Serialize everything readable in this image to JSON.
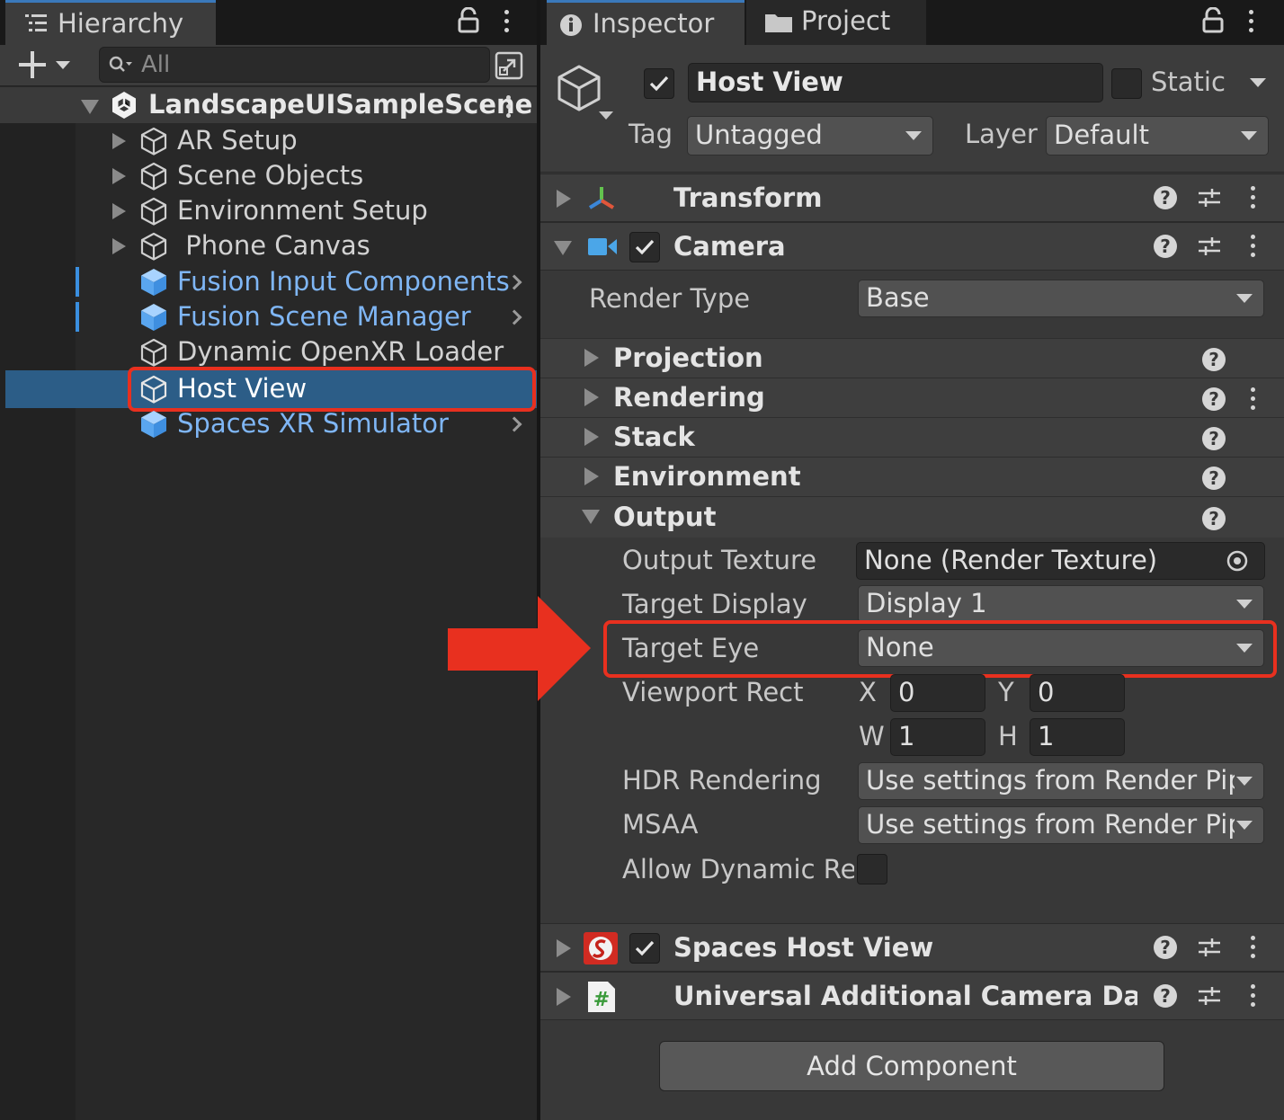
{
  "hierarchy": {
    "tab_title": "Hierarchy",
    "search_placeholder": "All",
    "scene_name": "LandscapeUISampleScene",
    "items": [
      {
        "label": "AR Setup",
        "type": "gameobject",
        "expandable": true
      },
      {
        "label": "Scene Objects",
        "type": "gameobject",
        "expandable": true
      },
      {
        "label": "Environment Setup",
        "type": "gameobject",
        "expandable": true
      },
      {
        "label": " Phone Canvas",
        "type": "gameobject",
        "expandable": true
      },
      {
        "label": "Fusion Input Components",
        "type": "prefab",
        "expandable": false
      },
      {
        "label": "Fusion Scene Manager",
        "type": "prefab",
        "expandable": false
      },
      {
        "label": "Dynamic OpenXR Loader",
        "type": "gameobject",
        "expandable": false
      },
      {
        "label": "Host View",
        "type": "gameobject",
        "selected": true
      },
      {
        "label": "Spaces XR Simulator",
        "type": "prefab",
        "expandable": false
      }
    ]
  },
  "inspector": {
    "tab_title": "Inspector",
    "project_tab_title": "Project",
    "object_name": "Host View",
    "active": true,
    "static_label": "Static",
    "static_checked": false,
    "tag_label": "Tag",
    "tag_value": "Untagged",
    "layer_label": "Layer",
    "layer_value": "Default",
    "components": {
      "transform": "Transform",
      "camera": "Camera",
      "spaces_host_view": "Spaces Host View",
      "universal_data": "Universal Additional Camera Data (S"
    },
    "camera": {
      "render_type_label": "Render Type",
      "render_type_value": "Base",
      "sections": [
        "Projection",
        "Rendering",
        "Stack",
        "Environment",
        "Output"
      ],
      "output": {
        "output_texture_label": "Output Texture",
        "output_texture_value": "None (Render Texture)",
        "target_display_label": "Target Display",
        "target_display_value": "Display 1",
        "target_eye_label": "Target Eye",
        "target_eye_value": "None",
        "viewport_rect_label": "Viewport Rect",
        "x_label": "X",
        "x_value": "0",
        "y_label": "Y",
        "y_value": "0",
        "w_label": "W",
        "w_value": "1",
        "h_label": "H",
        "h_value": "1",
        "hdr_label": "HDR Rendering",
        "hdr_value": "Use settings from Render Pipe",
        "msaa_label": "MSAA",
        "msaa_value": "Use settings from Render Pipe",
        "dynamic_res_label": "Allow Dynamic Re:",
        "dynamic_res_checked": false
      }
    },
    "add_component_label": "Add Component"
  },
  "annotation": {
    "highlight_color": "#e8301f",
    "arrow_color": "#e8301f"
  },
  "colors": {
    "prefab_text": "#7fb6f5",
    "selection": "#2c5d87",
    "accent_tab": "#3a79bb"
  }
}
